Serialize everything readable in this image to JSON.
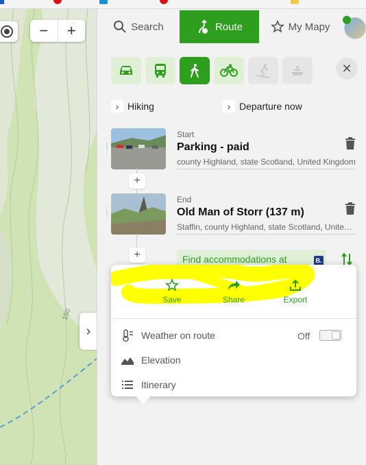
{
  "tabs": {
    "search": "Search",
    "route": "Route",
    "my_maps": "My Mapy"
  },
  "transport_modes": [
    "car",
    "public-transport",
    "walk",
    "bike",
    "ski",
    "boat"
  ],
  "active_mode": "walk",
  "route_options": {
    "profile": "Hiking",
    "time": "Departure now"
  },
  "points": [
    {
      "kind": "Start",
      "name": "Parking - paid",
      "address": "county Highland, state Scotland, United Kingdom"
    },
    {
      "kind": "End",
      "name": "Old Man of Storr (137 m)",
      "address": "Staffin, county Highland, state Scotland, United Kingdom"
    }
  ],
  "accommodation": {
    "label": "Find accommodations at",
    "badge": "B."
  },
  "popup": {
    "actions": [
      "Save",
      "Share",
      "Export"
    ],
    "weather_label": "Weather on route",
    "weather_state": "Off",
    "elevation_label": "Elevation",
    "itinerary_label": "Itinerary"
  },
  "map": {
    "contour_label": "150"
  },
  "colors": {
    "accent": "#2e9e1e",
    "highlight": "#ffff00"
  }
}
